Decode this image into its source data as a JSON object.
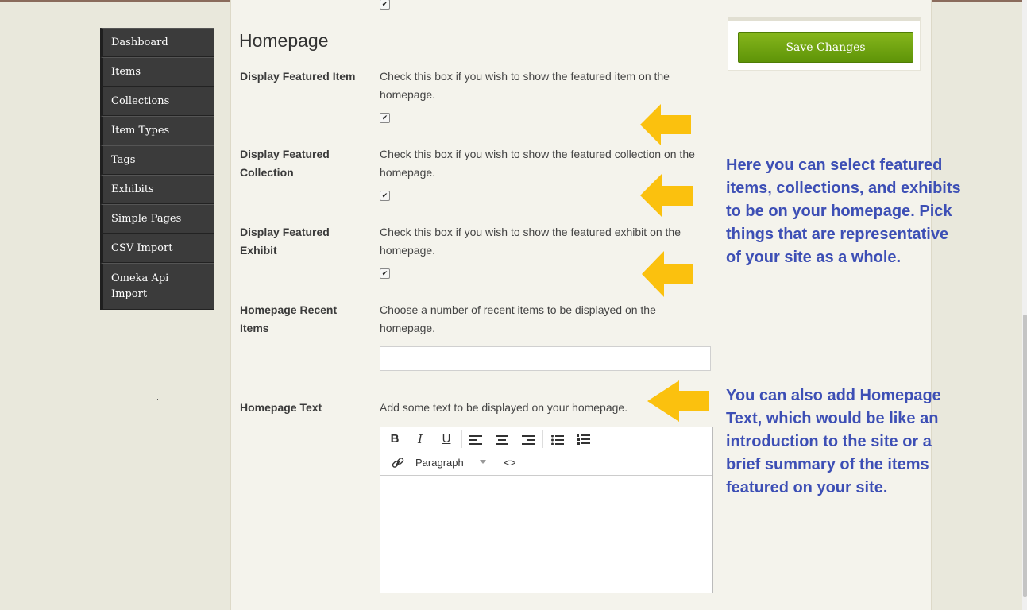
{
  "sidebar": {
    "items": [
      {
        "label": "Dashboard"
      },
      {
        "label": "Items"
      },
      {
        "label": "Collections"
      },
      {
        "label": "Item Types"
      },
      {
        "label": "Tags"
      },
      {
        "label": "Exhibits"
      },
      {
        "label": "Simple Pages"
      },
      {
        "label": "CSV Import"
      },
      {
        "label": "Omeka Api Import"
      }
    ]
  },
  "main": {
    "section_title": "Homepage",
    "fields": [
      {
        "label": "Display Featured Item",
        "description": "Check this box if you wish to show the featured item on the homepage.",
        "checked": true
      },
      {
        "label": "Display Featured Collection",
        "description": "Check this box if you wish to show the featured collection on the homepage.",
        "checked": true
      },
      {
        "label": "Display Featured Exhibit",
        "description": "Check this box if you wish to show the featured exhibit on the homepage.",
        "checked": true
      },
      {
        "label": "Homepage Recent Items",
        "description": "Choose a number of recent items to be displayed on the homepage.",
        "value": ""
      },
      {
        "label": "Homepage Text",
        "description": "Add some text to be displayed on your homepage."
      }
    ],
    "check_mark": "✔",
    "editor": {
      "toolbar": {
        "bold": "B",
        "italic": "I",
        "underline": "U",
        "format_select": "Paragraph",
        "code": "<>"
      }
    }
  },
  "save_panel": {
    "button_label": "Save Changes",
    "button_color": "#6ea312"
  },
  "annotations": {
    "featured": "Here you can select featured items, collections, and exhibits to be on your homepage. Pick things that are representative of your site as a whole.",
    "homepage_text": "You can also add Homepage Text, which would be like an introduction to the site or a brief summary of the items featured on your site.",
    "color": "#3d4fb5",
    "arrow_color": "#fbc10e"
  }
}
